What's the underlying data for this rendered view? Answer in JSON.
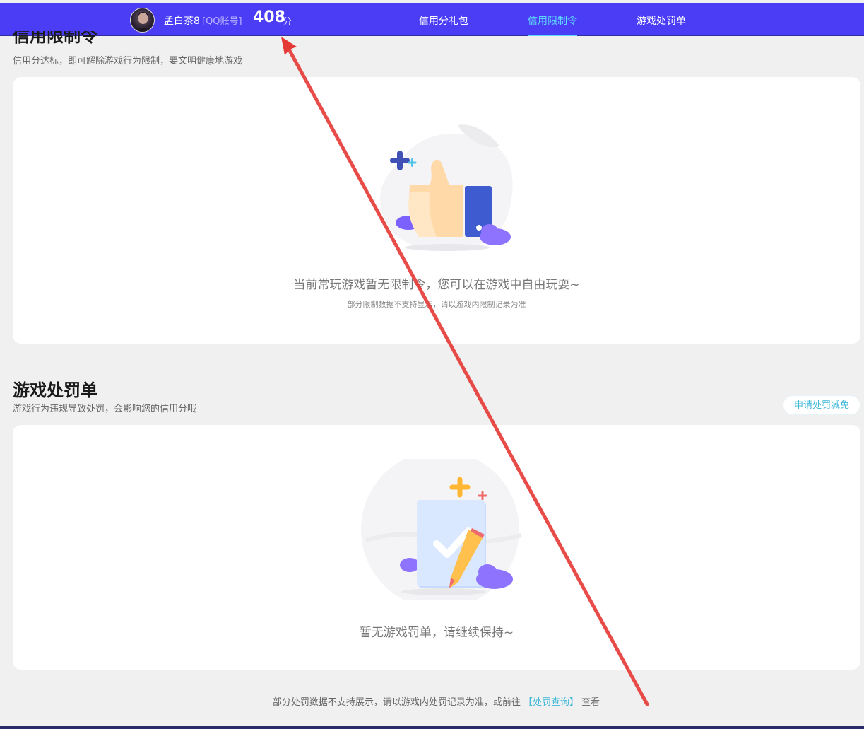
{
  "header": {
    "user_name": "孟白茶8",
    "account_type": "[QQ账号]",
    "score": "408",
    "score_unit": "分",
    "nav": [
      {
        "label": "信用分礼包",
        "active": false
      },
      {
        "label": "信用限制令",
        "active": true
      },
      {
        "label": "游戏处罚单",
        "active": false
      }
    ]
  },
  "restriction": {
    "title": "信用限制令",
    "subtitle": "信用分达标，即可解除游戏行为限制，要文明健康地游戏",
    "empty_text": "当前常玩游戏暂无限制令，您可以在游戏中自由玩耍~",
    "note": "部分限制数据不支持显示，请以游戏内限制记录为准"
  },
  "penalty": {
    "title": "游戏处罚单",
    "subtitle": "游戏行为违规导致处罚，会影响您的信用分哦",
    "apply_button": "申请处罚减免",
    "empty_text": "暂无游戏罚单，请继续保持~"
  },
  "footer": {
    "prefix": "部分处罚数据不支持展示，请以游戏内处罚记录为准，或前往",
    "link": "【处罚查询】",
    "suffix": "查看"
  },
  "colors": {
    "header_bg": "#4a3df5",
    "active_nav": "#5fd8ff",
    "link": "#3fb8d8",
    "annotation_arrow": "#e53935"
  }
}
